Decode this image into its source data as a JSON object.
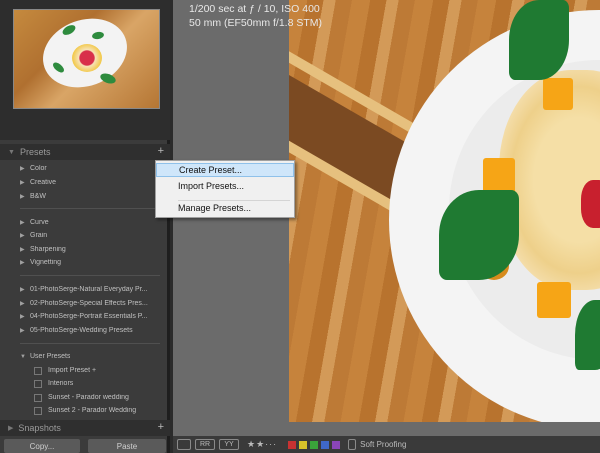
{
  "exif": {
    "line1": "1/200 sec at ƒ / 10, ISO 400",
    "line2": "50 mm (EF50mm f/1.8 STM)"
  },
  "presets_panel": {
    "title": "Presets",
    "groups_top": [
      "Color",
      "Creative",
      "B&W"
    ],
    "groups_mid": [
      "Curve",
      "Grain",
      "Sharpening",
      "Vignetting"
    ],
    "groups_ps": [
      "01-PhotoSerge-Natural Everyday Pr...",
      "02-PhotoSerge-Special Effects Pres...",
      "04-PhotoSerge-Portrait Essentials P...",
      "05-PhotoSerge-Wedding Presets"
    ],
    "user_presets": "User Presets",
    "user_items": [
      "Import Preset +",
      "Interiors",
      "Sunset - Parador wedding",
      "Sunset 2 - Parador Wedding"
    ]
  },
  "snapshots_panel": {
    "title": "Snapshots"
  },
  "buttons": {
    "copy": "Copy...",
    "paste": "Paste"
  },
  "context_menu": {
    "create": "Create Preset...",
    "import": "Import Presets...",
    "manage": "Manage Presets..."
  },
  "toolbar": {
    "view_single": "",
    "view_compare": "RR",
    "view_survey": "YY",
    "rating_stars": 2,
    "soft_proofing": "Soft Proofing"
  },
  "color_labels": [
    "#c83232",
    "#d8c22a",
    "#3aa33a",
    "#3f68c8",
    "#8a45b8"
  ],
  "icons": {
    "plus": "plus-icon",
    "triangle": "disclosure-triangle-icon"
  }
}
